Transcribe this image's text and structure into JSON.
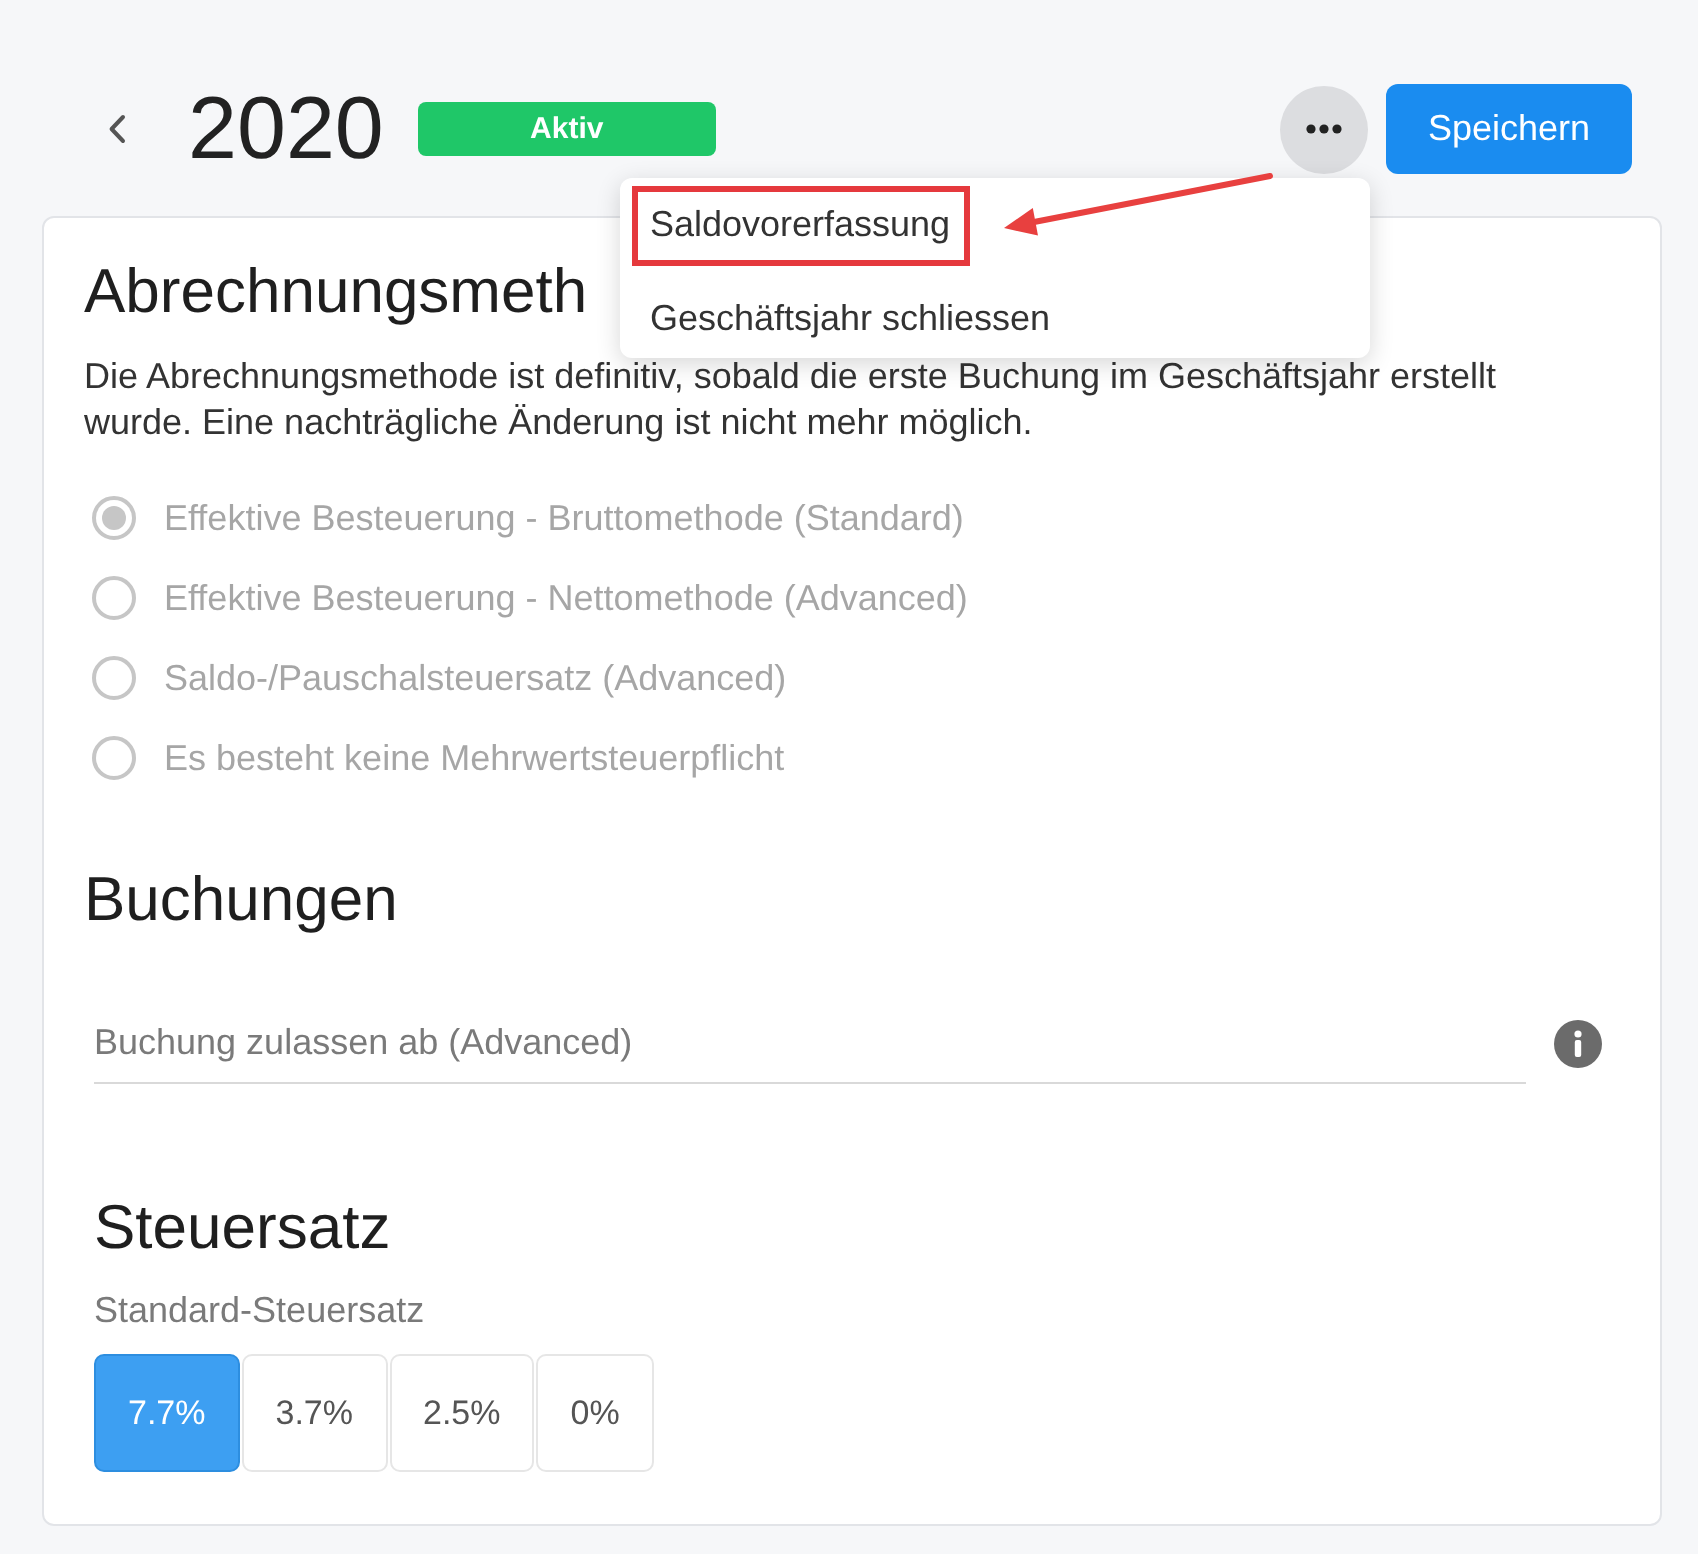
{
  "header": {
    "title": "2020",
    "status": "Aktiv",
    "save_button": "Speichern"
  },
  "menu": {
    "open": true,
    "items": [
      {
        "label": "Saldovorerfassung",
        "highlighted": true
      },
      {
        "label": "Geschäftsjahr schliessen",
        "highlighted": false
      }
    ]
  },
  "billing_method": {
    "heading": "Abrechnungsmeth",
    "description": "Die Abrechnungsmethode ist definitiv, sobald die erste Buchung im Geschäftsjahr erstellt wurde. Eine nachträgliche Änderung ist nicht mehr möglich.",
    "options": [
      {
        "label": "Effektive Besteuerung - Bruttomethode (Standard)",
        "selected": true,
        "disabled": true
      },
      {
        "label": "Effektive Besteuerung - Nettomethode (Advanced)",
        "selected": false,
        "disabled": true
      },
      {
        "label": "Saldo-/Pauschalsteuersatz (Advanced)",
        "selected": false,
        "disabled": true
      },
      {
        "label": "Es besteht keine Mehrwertsteuerpflicht",
        "selected": false,
        "disabled": true
      }
    ]
  },
  "bookings": {
    "heading": "Buchungen",
    "field": {
      "placeholder": "Buchung zulassen ab (Advanced)"
    }
  },
  "tax_rate": {
    "heading": "Steuersatz",
    "label": "Standard-Steuersatz",
    "options": [
      {
        "label": "7.7%",
        "selected": true
      },
      {
        "label": "3.7%",
        "selected": false
      },
      {
        "label": "2.5%",
        "selected": false
      },
      {
        "label": "0%",
        "selected": false
      }
    ]
  }
}
